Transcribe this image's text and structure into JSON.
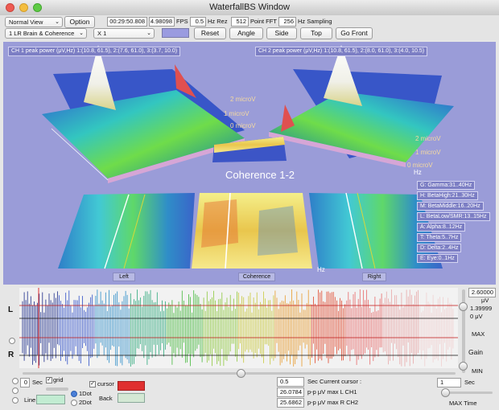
{
  "window": {
    "title": "WaterfallBS Window"
  },
  "toolbar": {
    "view_mode": "Normal View",
    "option_label": "Option",
    "montage": "1 LR Brain & Coherence",
    "zoom": "X 1",
    "time_value": "00:29:50.808",
    "fps_value": "4.98098",
    "fps_label": "FPS",
    "rez_value": "0.5",
    "rez_label": "Hz Rez",
    "fft_value": "512",
    "fft_label": "Point FFT",
    "sampling_value": "256",
    "sampling_label": "Hz Sampling",
    "buttons": [
      "Reset",
      "Angle",
      "Side",
      "Top",
      "Go Front"
    ],
    "color_swatch": "#9a9be0"
  },
  "view": {
    "ch1_header": "CH 1 peak power (μV,Hz) 1:(10.8, 61.5), 2:(7.6, 61.0), 3:(3.7, 10.0)",
    "ch2_header": "CH 2 peak power (μV,Hz) 1:(10.8, 61.5), 2:(8.0, 61.0), 3:(4.0, 10.5)",
    "coherence_title": "Coherence 1-2",
    "left_axis": [
      "2 microV",
      "1 microV",
      "0 microV"
    ],
    "right_axis": [
      "2 microV",
      "1 microV",
      "0 microV"
    ],
    "hz_label": "Hz",
    "bands": [
      "G: Gamma:31..40Hz",
      "H: BetaHigh:21..30Hz",
      "M: BetaMiddle:16..20Hz",
      "L: BetaLow/SMR:13..15Hz",
      "A: Alpha:8..12Hz",
      "T: Theta:5..7Hz",
      "D: Delta:2..4Hz",
      "E: Eye:0..1Hz"
    ],
    "panels": [
      "Left",
      "Coherence",
      "Right"
    ],
    "background": "#9a9cd8"
  },
  "trace": {
    "left_label": "L",
    "right_label": "R",
    "uv_top": "2.60000",
    "uv_unit": "μV",
    "uv_bottom": "1.39999",
    "zero_label": "0 μV",
    "gain_max": "MAX",
    "gain_label": "Gain",
    "gain_min": "MIN"
  },
  "controls": {
    "sec_value": "0",
    "sec_label": "Sec",
    "grid_label": "grid",
    "line_label": "Line",
    "dot1_label": "1Dot",
    "dot2_label": "2Dot",
    "cursor_label": "cursor",
    "back_label": "Back",
    "cursor_color": "#e03030",
    "back_color": "#d4e8d4",
    "line_color": "#c2ecd2",
    "cursor_sec_value": "0.5",
    "cursor_sec_label": "Sec Current cursor :",
    "l_value": "26.0784",
    "l_label": "p-p μV max L CH1",
    "r_value": "25.6862",
    "r_label": "p-p μV max R CH2",
    "max_time_value": "1",
    "max_time_sec": "Sec",
    "max_time_label": "MAX Time"
  }
}
